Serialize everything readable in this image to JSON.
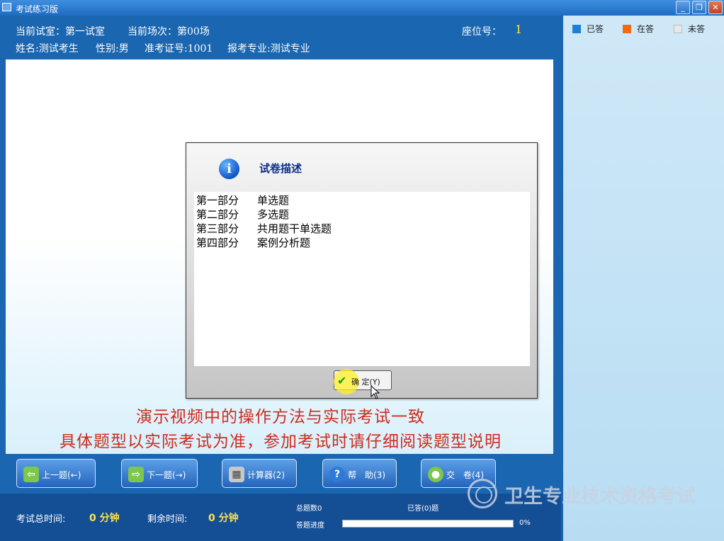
{
  "window": {
    "title": "考试练习版",
    "buttons": {
      "minimize": "_",
      "maximize": "❐",
      "close": "✕"
    }
  },
  "header": {
    "room_label": "当前试室：第一试室",
    "session_label": "当前场次：第00场",
    "seat_label": "座位号：",
    "seat_value": "1",
    "name_label": "姓名:测试考生",
    "gender_label": "性别:男",
    "ticket_label": "准考证号:1001",
    "major_label": "报考专业:测试专业"
  },
  "legend": {
    "answered": "已答",
    "current": "在答",
    "unanswered": "未答",
    "colors": {
      "answered": "#1e7fd6",
      "current": "#f26a11",
      "unanswered": "#e9e9e9"
    }
  },
  "dialog": {
    "title": "试卷描述",
    "icon": "info-icon",
    "parts": [
      {
        "part": "第一部分",
        "type": "单选题"
      },
      {
        "part": "第二部分",
        "type": "多选题"
      },
      {
        "part": "第三部分",
        "type": "共用题干单选题"
      },
      {
        "part": "第四部分",
        "type": "案例分析题"
      }
    ],
    "ok_label": "确 定(Y)"
  },
  "notice": {
    "line1": "演示视频中的操作方法与实际考试一致",
    "line2": "具体题型以实际考试为准，参加考试时请仔细阅读题型说明"
  },
  "toolbar": {
    "prev": "上一题(←)",
    "next": "下一题(→)",
    "calc": "计算器(2)",
    "help": "帮　助(3)",
    "submit": "交　卷(4)"
  },
  "status": {
    "total_time_label": "考试总时间:",
    "total_time_value": "0 分钟",
    "remaining_label": "剩余时间:",
    "remaining_value": "0 分钟",
    "total_questions": "总题数0",
    "answered_count": "已答(0)题",
    "progress_label": "答题进度",
    "progress_percent": "0%",
    "progress": 0
  },
  "watermark": "卫生专业技术资格考试"
}
